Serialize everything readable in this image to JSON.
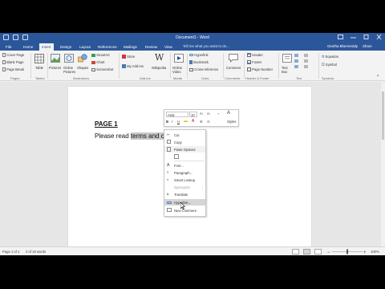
{
  "window": {
    "title": "Document1 - Word",
    "buttons": [
      "ribbon-display",
      "minimize",
      "maximize",
      "close"
    ]
  },
  "tabs": [
    "File",
    "Home",
    "Insert",
    "Design",
    "Layout",
    "References",
    "Mailings",
    "Review",
    "View"
  ],
  "active_tab": "Insert",
  "tell_me": "Tell me what you want to do...",
  "user_name": "Geetha Bhemreddy",
  "share_label": "Share",
  "ribbon": {
    "pages": {
      "items": [
        "Cover Page",
        "Blank Page",
        "Page Break"
      ],
      "label": "Pages"
    },
    "tables": {
      "item": "Table",
      "label": "Tables"
    },
    "illustrations": {
      "items": [
        "Pictures",
        "Online Pictures",
        "Shapes"
      ],
      "small": [
        "SmartArt",
        "Chart",
        "Screenshot"
      ],
      "label": "Illustrations"
    },
    "addins": {
      "items": [
        "Store",
        "My Add-ins",
        "Wikipedia"
      ],
      "label": "Add-ins"
    },
    "media": {
      "item": "Online Video",
      "label": "Media"
    },
    "links": {
      "items": [
        "Hyperlink",
        "Bookmark",
        "Cross-reference"
      ],
      "label": "Links"
    },
    "comments": {
      "item": "Comment",
      "label": "Comments"
    },
    "header_footer": {
      "items": [
        "Header",
        "Footer",
        "Page Number"
      ],
      "label": "Header & Footer"
    },
    "text": {
      "item": "Text Box",
      "label": "Text"
    },
    "symbols": {
      "items": [
        "Equation",
        "Symbol"
      ],
      "label": "Symbols"
    }
  },
  "document": {
    "heading": "PAGE 1",
    "body_before": "Please read ",
    "body_selected": "terms and conditions"
  },
  "mini_toolbar": {
    "font": "Arial",
    "size": "10",
    "bold": "B",
    "italic": "I",
    "underline": "U",
    "styles": "Styles"
  },
  "context_menu": {
    "items": [
      "Cut",
      "Copy",
      "Paste Options:",
      "Font...",
      "Paragraph...",
      "Smart Lookup",
      "Synonyms",
      "Translate",
      "Hyperlink...",
      "New Comment"
    ],
    "highlighted": "Hyperlink..."
  },
  "status": {
    "page": "Page 1 of 1",
    "words": "3 of 18 words",
    "zoom": "100%"
  },
  "colors": {
    "word_blue": "#2b579a",
    "ribbon_bg": "#f3f3f3",
    "selection": "#c8c8c8"
  }
}
